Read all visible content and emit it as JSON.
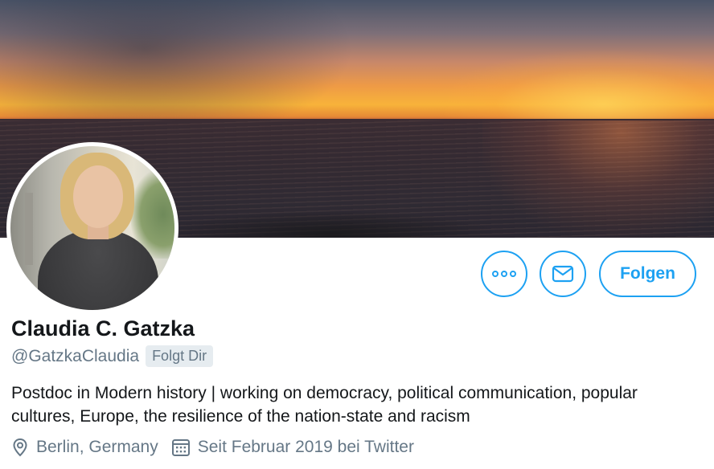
{
  "profile": {
    "name": "Claudia C. Gatzka",
    "handle": "@GatzkaClaudia",
    "follows_badge": "Folgt Dir",
    "bio": "Postdoc in Modern history | working on democracy, political communication, popular cultures, Europe, the resilience of the nation-state and racism",
    "location": "Berlin, Germany",
    "joined": "Seit Februar 2019 bei Twitter"
  },
  "actions": {
    "more_icon": "more-options-icon",
    "message_icon": "envelope-icon",
    "follow_label": "Folgen"
  },
  "icons": {
    "location": "location-pin-icon",
    "joined": "calendar-icon"
  },
  "colors": {
    "accent": "#1da1f2",
    "text_primary": "#14171a",
    "text_secondary": "#657786",
    "badge_bg": "#e6ecf0"
  }
}
